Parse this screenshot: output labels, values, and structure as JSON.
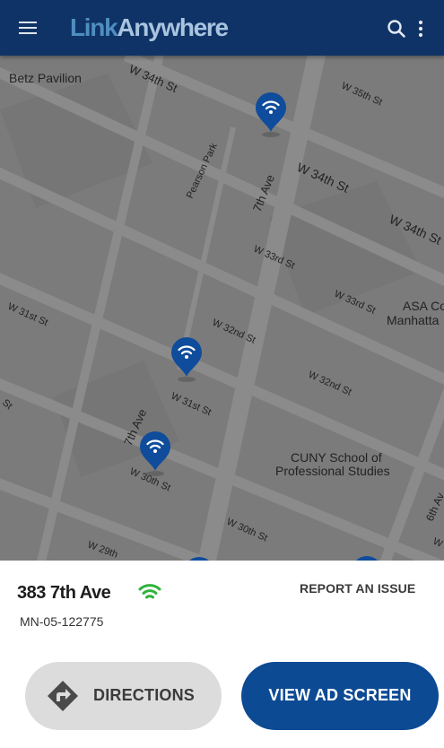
{
  "app": {
    "logo_part1": "Link",
    "logo_part2": "Anywhere",
    "icons": {
      "menu": "hamburger-menu-icon",
      "search": "search-icon",
      "more": "more-vert-icon"
    }
  },
  "map": {
    "place_labels": [
      "Betz Pavilion",
      "Pearson Park",
      "ASA Co",
      "Manhatta",
      "CUNY School of",
      "Professional Studies"
    ],
    "street_labels": [
      "W 34th St",
      "W 35th St",
      "W 34th St",
      "W 34th St",
      "7th Ave",
      "W 33rd St",
      "W 33rd St",
      "W 31st St",
      "W 32nd St",
      "W 32nd St",
      "W 31st St",
      "7th Ave",
      "W 30th St",
      "W 30th St",
      "W 29th",
      "6th Av",
      "W",
      "St"
    ],
    "pin_icon": "wifi-kiosk-pin-icon"
  },
  "sheet": {
    "address": "383 7th Ave",
    "kiosk_id": "MN-05-122775",
    "report_label": "REPORT AN ISSUE",
    "directions_label": "DIRECTIONS",
    "view_ad_label": "VIEW AD SCREEN",
    "wifi_status_color": "#2fb33a"
  },
  "colors": {
    "appbar": "#0f3366",
    "primary_button": "#0d4a94",
    "pin": "#0f4c9c"
  }
}
